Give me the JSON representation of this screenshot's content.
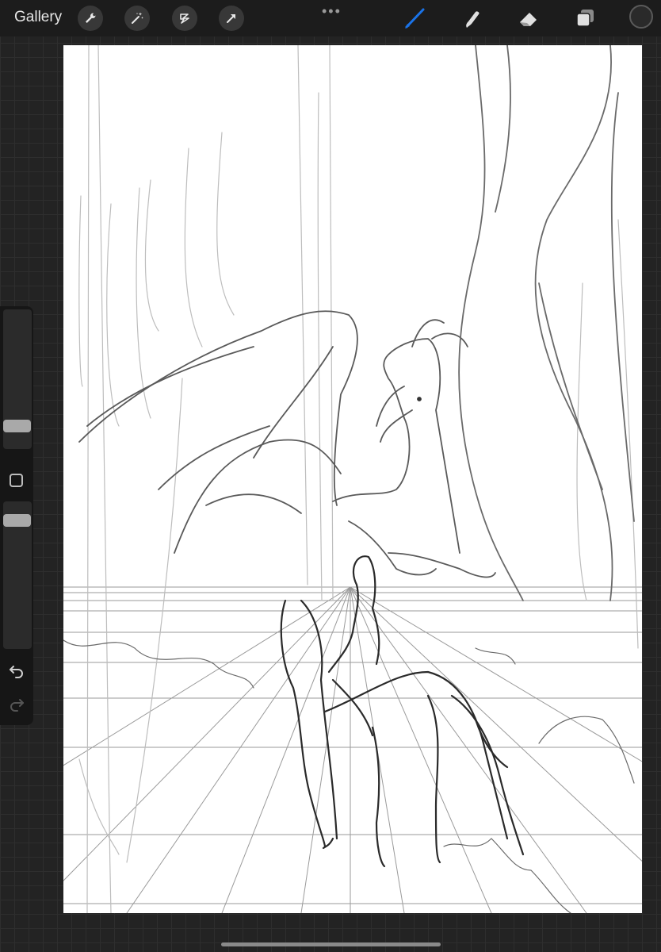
{
  "toolbar": {
    "gallery_label": "Gallery",
    "left_tools": [
      "wrench-icon",
      "magic-wand-icon",
      "selection-icon",
      "transform-arrow-icon"
    ],
    "right_tools": [
      "brush-icon",
      "smudge-icon",
      "eraser-icon",
      "layers-icon"
    ],
    "active_tool": "brush-icon",
    "accent_color": "#1a73e8",
    "current_color": "#2a2a2a"
  },
  "sidebar": {
    "brush_size": 0.3,
    "brush_opacity": 0.35
  },
  "canvas": {
    "background": "#ffffff",
    "subject": "sketch"
  }
}
